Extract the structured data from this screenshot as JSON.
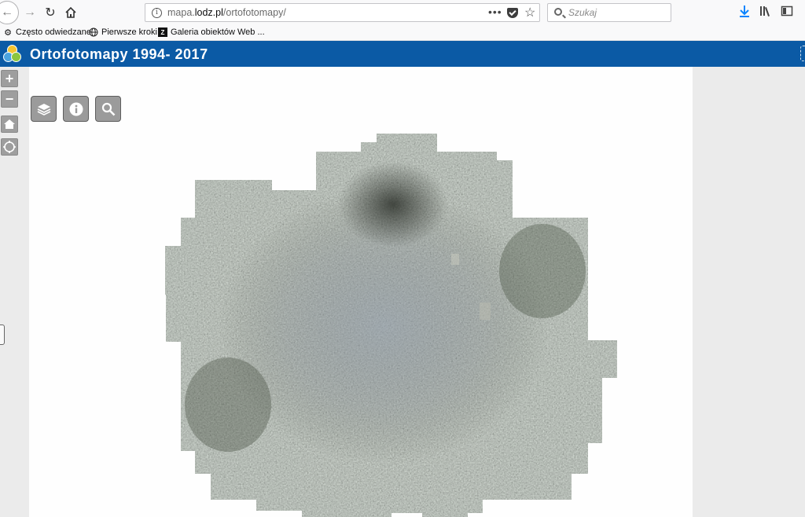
{
  "browser": {
    "url_prefix": "mapa.",
    "url_domain": "lodz.pl",
    "url_path": "/ortofotomapy/",
    "search_placeholder": "Szukaj",
    "meatball": "•••"
  },
  "bookmarks": [
    {
      "label": "Często odwiedzane",
      "icon": "gear-icon"
    },
    {
      "label": "Pierwsze kroki",
      "icon": "globe-icon"
    },
    {
      "label": "Galeria obiektów Web ...",
      "icon": "web-gallery-icon"
    }
  ],
  "app": {
    "title": "Ortofotomapy 1994- 2017"
  },
  "map_controls": {
    "zoom_in": "+",
    "zoom_out": "−"
  },
  "tools": [
    {
      "name": "layers-button",
      "icon": "layers-icon"
    },
    {
      "name": "info-button",
      "icon": "info-icon"
    },
    {
      "name": "search-button",
      "icon": "search-icon"
    }
  ],
  "colors": {
    "header_bg": "#0b5aa5",
    "panel_bg": "#ebebeb",
    "tool_bg": "#9b9b9b"
  }
}
